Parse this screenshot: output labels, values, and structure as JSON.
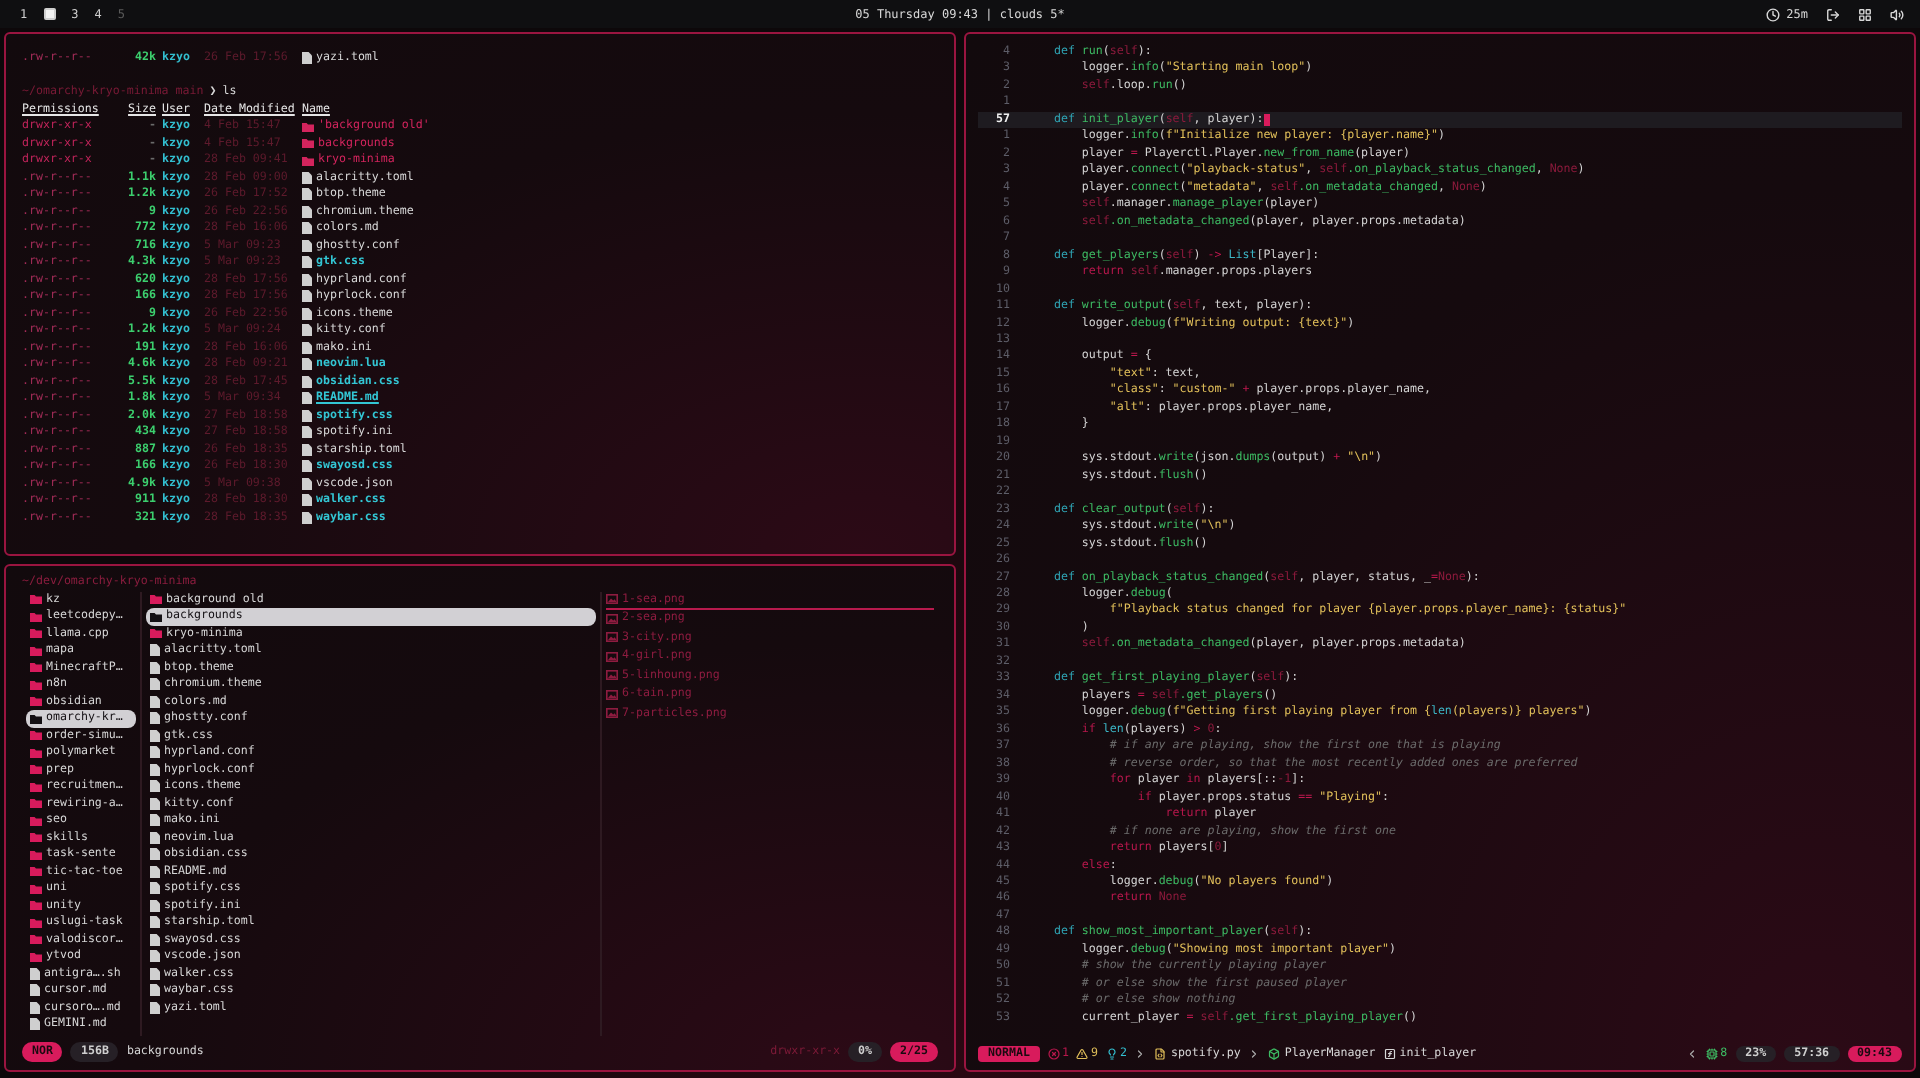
{
  "top_bar": {
    "workspaces": [
      {
        "kind": "number",
        "label": "1",
        "selected": false,
        "occupied": true
      },
      {
        "kind": "square",
        "selected": true,
        "occupied": true
      },
      {
        "kind": "number",
        "label": "3",
        "selected": false,
        "occupied": true
      },
      {
        "kind": "number",
        "label": "4",
        "selected": false,
        "occupied": true
      },
      {
        "kind": "number",
        "label": "5",
        "selected": false,
        "occupied": false
      }
    ],
    "clock": "05 Thursday 09:43 | clouds 5*",
    "timer": "25m"
  },
  "terminal": {
    "previous_row": {
      "perms": ".rw-r--r--",
      "size": "42k",
      "user": "kzyo",
      "date": "26 Feb 17:56",
      "name": "yazi.toml"
    },
    "prompt": {
      "path": "~/omarchy-kryo-minima main",
      "symbol": "❯",
      "command": "ls"
    },
    "columns": [
      "Permissions",
      "Size",
      "User",
      "Date Modified",
      "Name"
    ],
    "rows": [
      {
        "kind": "dir",
        "perms": "drwxr-xr-x",
        "size": "-",
        "user": "kzyo",
        "date": "4 Feb 15:47",
        "name": "'background old'"
      },
      {
        "kind": "dir",
        "perms": "drwxr-xr-x",
        "size": "-",
        "user": "kzyo",
        "date": "4 Feb 15:47",
        "name": "backgrounds"
      },
      {
        "kind": "dir",
        "perms": "drwxr-xr-x",
        "size": "-",
        "user": "kzyo",
        "date": "28 Feb 09:41",
        "name": "kryo-minima"
      },
      {
        "kind": "plain",
        "perms": ".rw-r--r--",
        "size": "1.1k",
        "user": "kzyo",
        "date": "28 Feb 09:00",
        "name": "alacritty.toml"
      },
      {
        "kind": "plain",
        "perms": ".rw-r--r--",
        "size": "1.2k",
        "user": "kzyo",
        "date": "26 Feb 17:52",
        "name": "btop.theme"
      },
      {
        "kind": "plain",
        "perms": ".rw-r--r--",
        "size": "9",
        "user": "kzyo",
        "date": "26 Feb 22:56",
        "name": "chromium.theme"
      },
      {
        "kind": "plain",
        "perms": ".rw-r--r--",
        "size": "772",
        "user": "kzyo",
        "date": "28 Feb 16:06",
        "name": "colors.md"
      },
      {
        "kind": "plain",
        "perms": ".rw-r--r--",
        "size": "716",
        "user": "kzyo",
        "date": "5 Mar 09:23",
        "name": "ghostty.conf"
      },
      {
        "kind": "bold",
        "perms": ".rw-r--r--",
        "size": "4.3k",
        "user": "kzyo",
        "date": "5 Mar 09:23",
        "name": "gtk.css"
      },
      {
        "kind": "plain",
        "perms": ".rw-r--r--",
        "size": "620",
        "user": "kzyo",
        "date": "28 Feb 17:56",
        "name": "hyprland.conf"
      },
      {
        "kind": "plain",
        "perms": ".rw-r--r--",
        "size": "166",
        "user": "kzyo",
        "date": "28 Feb 17:56",
        "name": "hyprlock.conf"
      },
      {
        "kind": "plain",
        "perms": ".rw-r--r--",
        "size": "9",
        "user": "kzyo",
        "date": "26 Feb 22:56",
        "name": "icons.theme"
      },
      {
        "kind": "plain",
        "perms": ".rw-r--r--",
        "size": "1.2k",
        "user": "kzyo",
        "date": "5 Mar 09:24",
        "name": "kitty.conf"
      },
      {
        "kind": "plain",
        "perms": ".rw-r--r--",
        "size": "191",
        "user": "kzyo",
        "date": "28 Feb 16:06",
        "name": "mako.ini"
      },
      {
        "kind": "bold",
        "perms": ".rw-r--r--",
        "size": "4.6k",
        "user": "kzyo",
        "date": "28 Feb 09:21",
        "name": "neovim.lua"
      },
      {
        "kind": "bold",
        "perms": ".rw-r--r--",
        "size": "5.5k",
        "user": "kzyo",
        "date": "28 Feb 17:45",
        "name": "obsidian.css"
      },
      {
        "kind": "link",
        "perms": ".rw-r--r--",
        "size": "1.8k",
        "user": "kzyo",
        "date": "5 Mar 09:34",
        "name": "README.md"
      },
      {
        "kind": "bold",
        "perms": ".rw-r--r--",
        "size": "2.0k",
        "user": "kzyo",
        "date": "27 Feb 18:58",
        "name": "spotify.css"
      },
      {
        "kind": "plain",
        "perms": ".rw-r--r--",
        "size": "434",
        "user": "kzyo",
        "date": "27 Feb 18:58",
        "name": "spotify.ini"
      },
      {
        "kind": "plain",
        "perms": ".rw-r--r--",
        "size": "887",
        "user": "kzyo",
        "date": "26 Feb 18:35",
        "name": "starship.toml"
      },
      {
        "kind": "bold",
        "perms": ".rw-r--r--",
        "size": "166",
        "user": "kzyo",
        "date": "26 Feb 18:30",
        "name": "swayosd.css"
      },
      {
        "kind": "plain",
        "perms": ".rw-r--r--",
        "size": "4.9k",
        "user": "kzyo",
        "date": "5 Mar 09:38",
        "name": "vscode.json"
      },
      {
        "kind": "bold",
        "perms": ".rw-r--r--",
        "size": "911",
        "user": "kzyo",
        "date": "28 Feb 18:30",
        "name": "walker.css"
      },
      {
        "kind": "bold",
        "perms": ".rw-r--r--",
        "size": "321",
        "user": "kzyo",
        "date": "28 Feb 18:35",
        "name": "waybar.css"
      }
    ]
  },
  "file_manager": {
    "path": "~/dev/omarchy-kryo-minima",
    "parent": [
      {
        "kind": "dir",
        "name": "kz",
        "selected": false
      },
      {
        "kind": "dir",
        "name": "leetcodepy…",
        "selected": false
      },
      {
        "kind": "dir",
        "name": "llama.cpp",
        "selected": false
      },
      {
        "kind": "dir",
        "name": "mapa",
        "selected": false
      },
      {
        "kind": "dir",
        "name": "MinecraftP…",
        "selected": false
      },
      {
        "kind": "dir",
        "name": "n8n",
        "selected": false
      },
      {
        "kind": "dir",
        "name": "obsidian",
        "selected": false
      },
      {
        "kind": "dir",
        "name": "omarchy-kr…",
        "selected": true
      },
      {
        "kind": "dir",
        "name": "order-simu…",
        "selected": false
      },
      {
        "kind": "dir",
        "name": "polymarket",
        "selected": false
      },
      {
        "kind": "dir",
        "name": "prep",
        "selected": false
      },
      {
        "kind": "dir",
        "name": "recruitmen…",
        "selected": false
      },
      {
        "kind": "dir",
        "name": "rewiring-a…",
        "selected": false
      },
      {
        "kind": "dir",
        "name": "seo",
        "selected": false
      },
      {
        "kind": "dir",
        "name": "skills",
        "selected": false
      },
      {
        "kind": "dir",
        "name": "task-sente",
        "selected": false
      },
      {
        "kind": "dir",
        "name": "tic-tac-toe",
        "selected": false
      },
      {
        "kind": "dir",
        "name": "uni",
        "selected": false
      },
      {
        "kind": "dir",
        "name": "unity",
        "selected": false
      },
      {
        "kind": "dir",
        "name": "uslugi-task",
        "selected": false
      },
      {
        "kind": "dir",
        "name": "valodiscor…",
        "selected": false
      },
      {
        "kind": "dir",
        "name": "ytvod",
        "selected": false
      },
      {
        "kind": "file",
        "name": "antigra….sh",
        "selected": false
      },
      {
        "kind": "file",
        "name": "cursor.md",
        "selected": false
      },
      {
        "kind": "file",
        "name": "cursoro….md",
        "selected": false
      },
      {
        "kind": "file",
        "name": "GEMINI.md",
        "selected": false
      }
    ],
    "current": [
      {
        "kind": "dir",
        "name": "background old",
        "selected": false
      },
      {
        "kind": "dir",
        "name": "backgrounds",
        "selected": true
      },
      {
        "kind": "dir",
        "name": "kryo-minima",
        "selected": false
      },
      {
        "kind": "file",
        "name": "alacritty.toml",
        "selected": false
      },
      {
        "kind": "file",
        "name": "btop.theme",
        "selected": false
      },
      {
        "kind": "file",
        "name": "chromium.theme",
        "selected": false
      },
      {
        "kind": "file",
        "name": "colors.md",
        "selected": false
      },
      {
        "kind": "file",
        "name": "ghostty.conf",
        "selected": false
      },
      {
        "kind": "file",
        "name": "gtk.css",
        "selected": false
      },
      {
        "kind": "file",
        "name": "hyprland.conf",
        "selected": false
      },
      {
        "kind": "file",
        "name": "hyprlock.conf",
        "selected": false
      },
      {
        "kind": "file",
        "name": "icons.theme",
        "selected": false
      },
      {
        "kind": "file",
        "name": "kitty.conf",
        "selected": false
      },
      {
        "kind": "file",
        "name": "mako.ini",
        "selected": false
      },
      {
        "kind": "file",
        "name": "neovim.lua",
        "selected": false
      },
      {
        "kind": "file",
        "name": "obsidian.css",
        "selected": false
      },
      {
        "kind": "file",
        "name": "README.md",
        "selected": false
      },
      {
        "kind": "file",
        "name": "spotify.css",
        "selected": false
      },
      {
        "kind": "file",
        "name": "spotify.ini",
        "selected": false
      },
      {
        "kind": "file",
        "name": "starship.toml",
        "selected": false
      },
      {
        "kind": "file",
        "name": "swayosd.css",
        "selected": false
      },
      {
        "kind": "file",
        "name": "vscode.json",
        "selected": false
      },
      {
        "kind": "file",
        "name": "walker.css",
        "selected": false
      },
      {
        "kind": "file",
        "name": "waybar.css",
        "selected": false
      },
      {
        "kind": "file",
        "name": "yazi.toml",
        "selected": false
      }
    ],
    "preview": [
      {
        "name": "1-sea.png",
        "selected": true
      },
      {
        "name": "2-sea.png",
        "selected": false
      },
      {
        "name": "3-city.png",
        "selected": false
      },
      {
        "name": "4-girl.png",
        "selected": false
      },
      {
        "name": "5-linhoung.png",
        "selected": false
      },
      {
        "name": "6-tain.png",
        "selected": false
      },
      {
        "name": "7-particles.png",
        "selected": false
      }
    ],
    "status": {
      "mode": "NOR",
      "size": "156B",
      "name": "backgrounds",
      "perms": "drwxr-xr-x",
      "percent": "0%",
      "position": "2/25"
    }
  },
  "editor": {
    "lines": [
      {
        "number": "4",
        "current": false,
        "tokens": [
          {
            "kind": "keyword",
            "text": "    def "
          },
          {
            "kind": "function",
            "text": "run"
          },
          {
            "kind": "plain",
            "text": "("
          },
          {
            "kind": "self",
            "text": "self"
          },
          {
            "kind": "plain",
            "text": "):"
          }
        ]
      },
      {
        "number": "3",
        "current": false,
        "tokens": [
          {
            "kind": "plain",
            "text": "        logger."
          },
          {
            "kind": "function",
            "text": "info"
          },
          {
            "kind": "plain",
            "text": "("
          },
          {
            "kind": "string",
            "text": "\"Starting main loop\""
          },
          {
            "kind": "plain",
            "text": ")"
          }
        ]
      },
      {
        "number": "2",
        "current": false,
        "tokens": [
          {
            "kind": "self",
            "text": "        self"
          },
          {
            "kind": "plain",
            "text": ".loop."
          },
          {
            "kind": "function",
            "text": "run"
          },
          {
            "kind": "plain",
            "text": "()"
          }
        ]
      },
      {
        "number": "1",
        "current": false
      },
      {
        "number": "57",
        "current": true,
        "tokens": [
          {
            "kind": "keyword",
            "text": "    def "
          },
          {
            "kind": "function",
            "text": "init_player"
          },
          {
            "kind": "plain",
            "text": "("
          },
          {
            "kind": "self",
            "text": "self"
          },
          {
            "kind": "plain",
            "text": ", player):"
          }
        ]
      },
      {
        "number": "1",
        "current": false,
        "tokens": [
          {
            "kind": "plain",
            "text": "        logger."
          },
          {
            "kind": "function",
            "text": "info"
          },
          {
            "kind": "plain",
            "text": "("
          },
          {
            "kind": "string",
            "text": "f\"Initialize new player: {player.name}\""
          },
          {
            "kind": "plain",
            "text": ")"
          }
        ]
      },
      {
        "number": "2",
        "current": false,
        "tokens": [
          {
            "kind": "plain",
            "text": "        player "
          },
          {
            "kind": "operator",
            "text": "="
          },
          {
            "kind": "plain",
            "text": " Playerctl.Player."
          },
          {
            "kind": "function",
            "text": "new_from_name"
          },
          {
            "kind": "plain",
            "text": "(player)"
          }
        ]
      },
      {
        "number": "3",
        "current": false,
        "tokens": [
          {
            "kind": "plain",
            "text": "        player."
          },
          {
            "kind": "function",
            "text": "connect"
          },
          {
            "kind": "plain",
            "text": "("
          },
          {
            "kind": "string",
            "text": "\"playback-status\""
          },
          {
            "kind": "plain",
            "text": ", "
          },
          {
            "kind": "self",
            "text": "self"
          },
          {
            "kind": "function",
            "text": ".on_playback_status_changed"
          },
          {
            "kind": "plain",
            "text": ", "
          },
          {
            "kind": "constant",
            "text": "None"
          },
          {
            "kind": "plain",
            "text": ")"
          }
        ]
      },
      {
        "number": "4",
        "current": false,
        "tokens": [
          {
            "kind": "plain",
            "text": "        player."
          },
          {
            "kind": "function",
            "text": "connect"
          },
          {
            "kind": "plain",
            "text": "("
          },
          {
            "kind": "string",
            "text": "\"metadata\""
          },
          {
            "kind": "plain",
            "text": ", "
          },
          {
            "kind": "self",
            "text": "self"
          },
          {
            "kind": "function",
            "text": ".on_metadata_changed"
          },
          {
            "kind": "plain",
            "text": ", "
          },
          {
            "kind": "constant",
            "text": "None"
          },
          {
            "kind": "plain",
            "text": ")"
          }
        ]
      },
      {
        "number": "5",
        "current": false,
        "tokens": [
          {
            "kind": "self",
            "text": "        self"
          },
          {
            "kind": "plain",
            "text": ".manager."
          },
          {
            "kind": "function",
            "text": "manage_player"
          },
          {
            "kind": "plain",
            "text": "(player)"
          }
        ]
      },
      {
        "number": "6",
        "current": false,
        "tokens": [
          {
            "kind": "self",
            "text": "        self"
          },
          {
            "kind": "function",
            "text": ".on_metadata_changed"
          },
          {
            "kind": "plain",
            "text": "(player, player.props.metadata)"
          }
        ]
      },
      {
        "number": "7",
        "current": false
      },
      {
        "number": "8",
        "current": false,
        "tokens": [
          {
            "kind": "keyword",
            "text": "    def "
          },
          {
            "kind": "function",
            "text": "get_players"
          },
          {
            "kind": "plain",
            "text": "("
          },
          {
            "kind": "self",
            "text": "self"
          },
          {
            "kind": "plain",
            "text": ") "
          },
          {
            "kind": "operator",
            "text": "->"
          },
          {
            "kind": "builtin",
            "text": " List"
          },
          {
            "kind": "plain",
            "text": "[Player]:"
          }
        ]
      },
      {
        "number": "9",
        "current": false,
        "tokens": [
          {
            "kind": "control",
            "text": "        return "
          },
          {
            "kind": "self",
            "text": "self"
          },
          {
            "kind": "plain",
            "text": ".manager.props.players"
          }
        ]
      },
      {
        "number": "10",
        "current": false
      },
      {
        "number": "11",
        "current": false,
        "tokens": [
          {
            "kind": "keyword",
            "text": "    def "
          },
          {
            "kind": "function",
            "text": "write_output"
          },
          {
            "kind": "plain",
            "text": "("
          },
          {
            "kind": "self",
            "text": "self"
          },
          {
            "kind": "plain",
            "text": ", text, player):"
          }
        ]
      },
      {
        "number": "12",
        "current": false,
        "tokens": [
          {
            "kind": "plain",
            "text": "        logger."
          },
          {
            "kind": "function",
            "text": "debug"
          },
          {
            "kind": "plain",
            "text": "("
          },
          {
            "kind": "string",
            "text": "f\"Writing output: {text}\""
          },
          {
            "kind": "plain",
            "text": ")"
          }
        ]
      },
      {
        "number": "13",
        "current": false
      },
      {
        "number": "14",
        "current": false,
        "tokens": [
          {
            "kind": "plain",
            "text": "        output "
          },
          {
            "kind": "operator",
            "text": "="
          },
          {
            "kind": "plain",
            "text": " {"
          }
        ]
      },
      {
        "number": "15",
        "current": false,
        "tokens": [
          {
            "kind": "string",
            "text": "            \"text\""
          },
          {
            "kind": "plain",
            "text": ": text,"
          }
        ]
      },
      {
        "number": "16",
        "current": false,
        "tokens": [
          {
            "kind": "string",
            "text": "            \"class\""
          },
          {
            "kind": "plain",
            "text": ": "
          },
          {
            "kind": "string",
            "text": "\"custom-\""
          },
          {
            "kind": "operator",
            "text": " +"
          },
          {
            "kind": "plain",
            "text": " player.props.player_name,"
          }
        ]
      },
      {
        "number": "17",
        "current": false,
        "tokens": [
          {
            "kind": "string",
            "text": "            \"alt\""
          },
          {
            "kind": "plain",
            "text": ": player.props.player_name,"
          }
        ]
      },
      {
        "number": "18",
        "current": false,
        "tokens": [
          {
            "kind": "plain",
            "text": "        }"
          }
        ]
      },
      {
        "number": "19",
        "current": false
      },
      {
        "number": "20",
        "current": false,
        "tokens": [
          {
            "kind": "plain",
            "text": "        sys.stdout."
          },
          {
            "kind": "function",
            "text": "write"
          },
          {
            "kind": "plain",
            "text": "(json."
          },
          {
            "kind": "function",
            "text": "dumps"
          },
          {
            "kind": "plain",
            "text": "(output) "
          },
          {
            "kind": "operator",
            "text": "+"
          },
          {
            "kind": "string",
            "text": " \"\\n\""
          },
          {
            "kind": "plain",
            "text": ")"
          }
        ]
      },
      {
        "number": "21",
        "current": false,
        "tokens": [
          {
            "kind": "plain",
            "text": "        sys.stdout."
          },
          {
            "kind": "function",
            "text": "flush"
          },
          {
            "kind": "plain",
            "text": "()"
          }
        ]
      },
      {
        "number": "22",
        "current": false
      },
      {
        "number": "23",
        "current": false,
        "tokens": [
          {
            "kind": "keyword",
            "text": "    def "
          },
          {
            "kind": "function",
            "text": "clear_output"
          },
          {
            "kind": "plain",
            "text": "("
          },
          {
            "kind": "self",
            "text": "self"
          },
          {
            "kind": "plain",
            "text": "):"
          }
        ]
      },
      {
        "number": "24",
        "current": false,
        "tokens": [
          {
            "kind": "plain",
            "text": "        sys.stdout."
          },
          {
            "kind": "function",
            "text": "write"
          },
          {
            "kind": "plain",
            "text": "("
          },
          {
            "kind": "string",
            "text": "\"\\n\""
          },
          {
            "kind": "plain",
            "text": ")"
          }
        ]
      },
      {
        "number": "25",
        "current": false,
        "tokens": [
          {
            "kind": "plain",
            "text": "        sys.stdout."
          },
          {
            "kind": "function",
            "text": "flush"
          },
          {
            "kind": "plain",
            "text": "()"
          }
        ]
      },
      {
        "number": "26",
        "current": false
      },
      {
        "number": "27",
        "current": false,
        "tokens": [
          {
            "kind": "keyword",
            "text": "    def "
          },
          {
            "kind": "function",
            "text": "on_playback_status_changed"
          },
          {
            "kind": "plain",
            "text": "("
          },
          {
            "kind": "self",
            "text": "self"
          },
          {
            "kind": "plain",
            "text": ", player, status, _"
          },
          {
            "kind": "operator",
            "text": "="
          },
          {
            "kind": "constant",
            "text": "None"
          },
          {
            "kind": "plain",
            "text": "):"
          }
        ]
      },
      {
        "number": "28",
        "current": false,
        "tokens": [
          {
            "kind": "plain",
            "text": "        logger."
          },
          {
            "kind": "function",
            "text": "debug"
          },
          {
            "kind": "plain",
            "text": "("
          }
        ]
      },
      {
        "number": "29",
        "current": false,
        "tokens": [
          {
            "kind": "string",
            "text": "            f\"Playback status changed for player {player.props.player_name}: {status}\""
          }
        ]
      },
      {
        "number": "30",
        "current": false,
        "tokens": [
          {
            "kind": "plain",
            "text": "        )"
          }
        ]
      },
      {
        "number": "31",
        "current": false,
        "tokens": [
          {
            "kind": "self",
            "text": "        self"
          },
          {
            "kind": "function",
            "text": ".on_metadata_changed"
          },
          {
            "kind": "plain",
            "text": "(player, player.props.metadata)"
          }
        ]
      },
      {
        "number": "32",
        "current": false
      },
      {
        "number": "33",
        "current": false,
        "tokens": [
          {
            "kind": "keyword",
            "text": "    def "
          },
          {
            "kind": "function",
            "text": "get_first_playing_player"
          },
          {
            "kind": "plain",
            "text": "("
          },
          {
            "kind": "self",
            "text": "self"
          },
          {
            "kind": "plain",
            "text": "):"
          }
        ]
      },
      {
        "number": "34",
        "current": false,
        "tokens": [
          {
            "kind": "plain",
            "text": "        players "
          },
          {
            "kind": "operator",
            "text": "="
          },
          {
            "kind": "self",
            "text": " self"
          },
          {
            "kind": "function",
            "text": ".get_players"
          },
          {
            "kind": "plain",
            "text": "()"
          }
        ]
      },
      {
        "number": "35",
        "current": false,
        "tokens": [
          {
            "kind": "plain",
            "text": "        logger."
          },
          {
            "kind": "function",
            "text": "debug"
          },
          {
            "kind": "plain",
            "text": "("
          },
          {
            "kind": "string",
            "text": "f\"Getting first playing player from {"
          },
          {
            "kind": "builtin",
            "text": "len"
          },
          {
            "kind": "string",
            "text": "(players)} players\""
          },
          {
            "kind": "plain",
            "text": ")"
          }
        ]
      },
      {
        "number": "36",
        "current": false,
        "tokens": [
          {
            "kind": "control",
            "text": "        if "
          },
          {
            "kind": "builtin",
            "text": "len"
          },
          {
            "kind": "plain",
            "text": "(players) "
          },
          {
            "kind": "operator",
            "text": ">"
          },
          {
            "kind": "constant",
            "text": " 0"
          },
          {
            "kind": "plain",
            "text": ":"
          }
        ]
      },
      {
        "number": "37",
        "current": false,
        "tokens": [
          {
            "kind": "comment",
            "text": "            # if any are playing, show the first one that is playing"
          }
        ]
      },
      {
        "number": "38",
        "current": false,
        "tokens": [
          {
            "kind": "comment",
            "text": "            # reverse order, so that the most recently added ones are preferred"
          }
        ]
      },
      {
        "number": "39",
        "current": false,
        "tokens": [
          {
            "kind": "control",
            "text": "            for "
          },
          {
            "kind": "plain",
            "text": "player "
          },
          {
            "kind": "control",
            "text": "in"
          },
          {
            "kind": "plain",
            "text": " players[::"
          },
          {
            "kind": "constant",
            "text": "-1"
          },
          {
            "kind": "plain",
            "text": "]:"
          }
        ]
      },
      {
        "number": "40",
        "current": false,
        "tokens": [
          {
            "kind": "control",
            "text": "                if "
          },
          {
            "kind": "plain",
            "text": "player.props.status "
          },
          {
            "kind": "operator",
            "text": "=="
          },
          {
            "kind": "string",
            "text": " \"Playing\""
          },
          {
            "kind": "plain",
            "text": ":"
          }
        ]
      },
      {
        "number": "41",
        "current": false,
        "tokens": [
          {
            "kind": "control",
            "text": "                    return "
          },
          {
            "kind": "plain",
            "text": "player"
          }
        ]
      },
      {
        "number": "42",
        "current": false,
        "tokens": [
          {
            "kind": "comment",
            "text": "            # if none are playing, show the first one"
          }
        ]
      },
      {
        "number": "43",
        "current": false,
        "tokens": [
          {
            "kind": "control",
            "text": "            return "
          },
          {
            "kind": "plain",
            "text": "players["
          },
          {
            "kind": "constant",
            "text": "0"
          },
          {
            "kind": "plain",
            "text": "]"
          }
        ]
      },
      {
        "number": "44",
        "current": false,
        "tokens": [
          {
            "kind": "control",
            "text": "        else"
          },
          {
            "kind": "plain",
            "text": ":"
          }
        ]
      },
      {
        "number": "45",
        "current": false,
        "tokens": [
          {
            "kind": "plain",
            "text": "            logger."
          },
          {
            "kind": "function",
            "text": "debug"
          },
          {
            "kind": "plain",
            "text": "("
          },
          {
            "kind": "string",
            "text": "\"No players found\""
          },
          {
            "kind": "plain",
            "text": ")"
          }
        ]
      },
      {
        "number": "46",
        "current": false,
        "tokens": [
          {
            "kind": "control",
            "text": "            return "
          },
          {
            "kind": "constant",
            "text": "None"
          }
        ]
      },
      {
        "number": "47",
        "current": false
      },
      {
        "number": "48",
        "current": false,
        "tokens": [
          {
            "kind": "keyword",
            "text": "    def "
          },
          {
            "kind": "function",
            "text": "show_most_important_player"
          },
          {
            "kind": "plain",
            "text": "("
          },
          {
            "kind": "self",
            "text": "self"
          },
          {
            "kind": "plain",
            "text": "):"
          }
        ]
      },
      {
        "number": "49",
        "current": false,
        "tokens": [
          {
            "kind": "plain",
            "text": "        logger."
          },
          {
            "kind": "function",
            "text": "debug"
          },
          {
            "kind": "plain",
            "text": "("
          },
          {
            "kind": "string",
            "text": "\"Showing most important player\""
          },
          {
            "kind": "plain",
            "text": ")"
          }
        ]
      },
      {
        "number": "50",
        "current": false,
        "tokens": [
          {
            "kind": "comment",
            "text": "        # show the currently playing player"
          }
        ]
      },
      {
        "number": "51",
        "current": false,
        "tokens": [
          {
            "kind": "comment",
            "text": "        # or else show the first paused player"
          }
        ]
      },
      {
        "number": "52",
        "current": false,
        "tokens": [
          {
            "kind": "comment",
            "text": "        # or else show nothing"
          }
        ]
      },
      {
        "number": "53",
        "current": false,
        "tokens": [
          {
            "kind": "plain",
            "text": "        current_player "
          },
          {
            "kind": "operator",
            "text": "="
          },
          {
            "kind": "self",
            "text": " self"
          },
          {
            "kind": "function",
            "text": ".get_first_playing_player"
          },
          {
            "kind": "plain",
            "text": "()"
          }
        ]
      }
    ],
    "status": {
      "mode": "NORMAL",
      "errors": "1",
      "warnings": "9",
      "hints": "2",
      "file": "spotify.py",
      "class": "PlayerManager",
      "function": "init_player",
      "lsp": "8",
      "percent": "23%",
      "position": "57:36",
      "time": "09:43"
    }
  }
}
